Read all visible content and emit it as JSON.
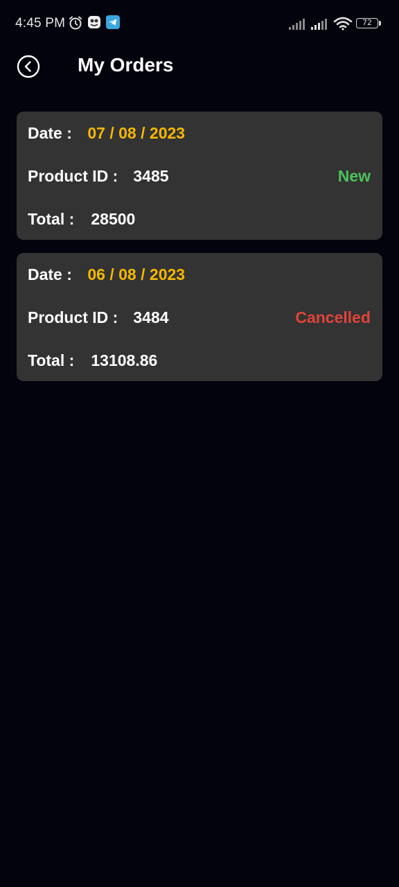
{
  "status_bar": {
    "time": "4:45 PM",
    "battery": "72"
  },
  "header": {
    "title": "My Orders"
  },
  "labels": {
    "date": "Date :",
    "product_id": "Product ID :",
    "total": "Total :"
  },
  "orders": [
    {
      "date": "07 / 08 / 2023",
      "product_id": "3485",
      "total": "28500",
      "status": "New",
      "status_color": "#4cc15a"
    },
    {
      "date": "06 / 08 / 2023",
      "product_id": "3484",
      "total": "13108.86",
      "status": "Cancelled",
      "status_color": "#e0433a"
    }
  ],
  "colors": {
    "background": "#03030d",
    "card": "#333333",
    "date_accent": "#f5b800"
  }
}
